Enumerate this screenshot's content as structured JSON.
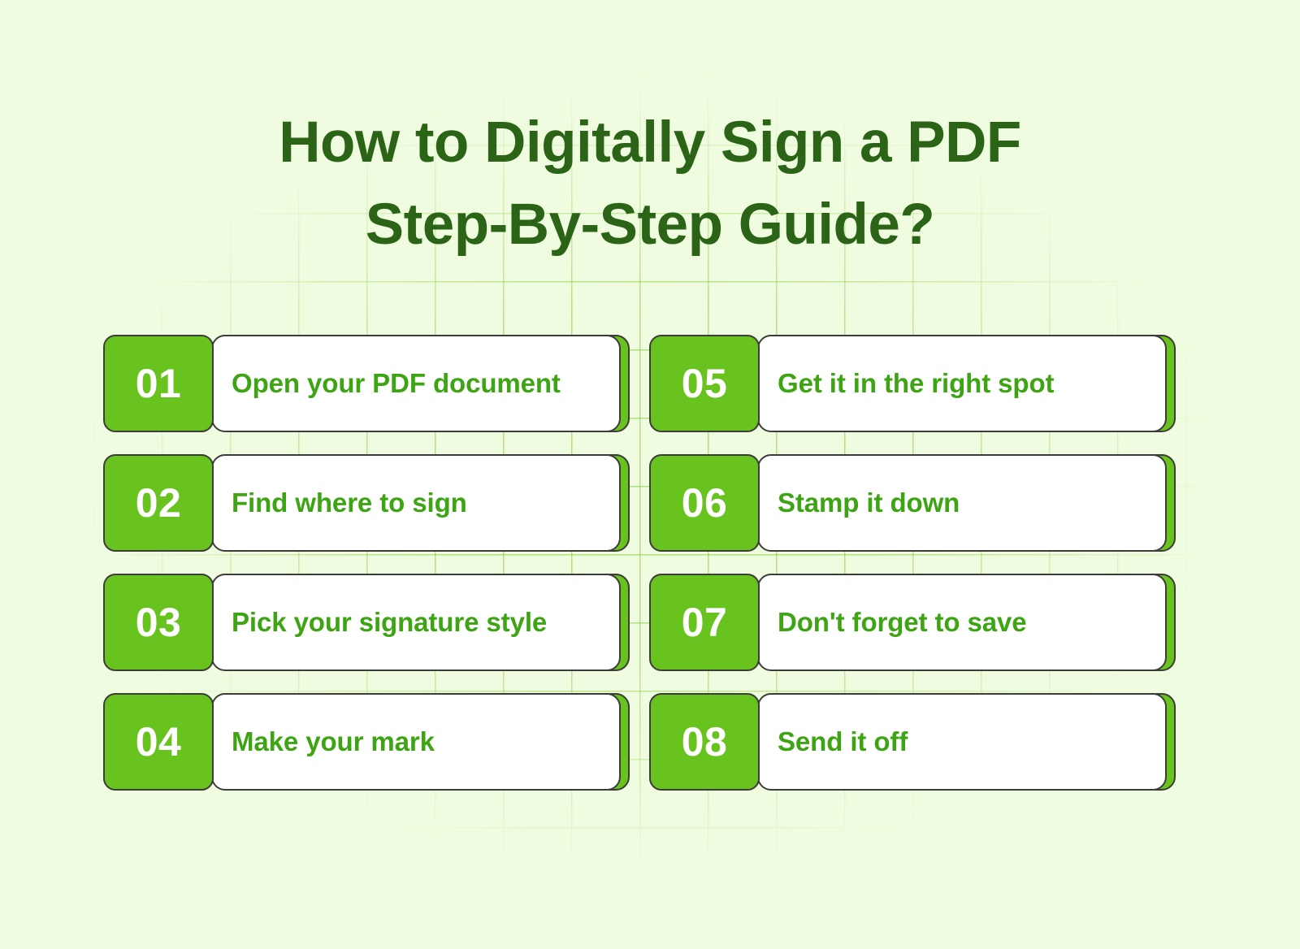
{
  "title": {
    "line1": "How to Digitally Sign a PDF",
    "line2": "Step-By-Step Guide?"
  },
  "colors": {
    "background": "#f0fce0",
    "grid_line": "#7cc828",
    "title_text": "#2b6317",
    "badge_fill": "#69c31e",
    "badge_number_text": "#ffffff",
    "card_fill": "#ffffff",
    "card_border": "#3c3c3a",
    "card_shadow_fill": "#69c31e",
    "label_text": "#3da513"
  },
  "steps": [
    {
      "number": "01",
      "label": "Open your PDF document"
    },
    {
      "number": "02",
      "label": "Find where to sign"
    },
    {
      "number": "03",
      "label": "Pick your signature style"
    },
    {
      "number": "04",
      "label": "Make your mark"
    },
    {
      "number": "05",
      "label": "Get it in the right spot"
    },
    {
      "number": "06",
      "label": "Stamp it down"
    },
    {
      "number": "07",
      "label": "Don't forget to save"
    },
    {
      "number": "08",
      "label": "Send it off"
    }
  ],
  "layout": {
    "columns": 2,
    "rows": 4,
    "column_order": "left column holds steps 01-04, right column holds steps 05-08"
  }
}
